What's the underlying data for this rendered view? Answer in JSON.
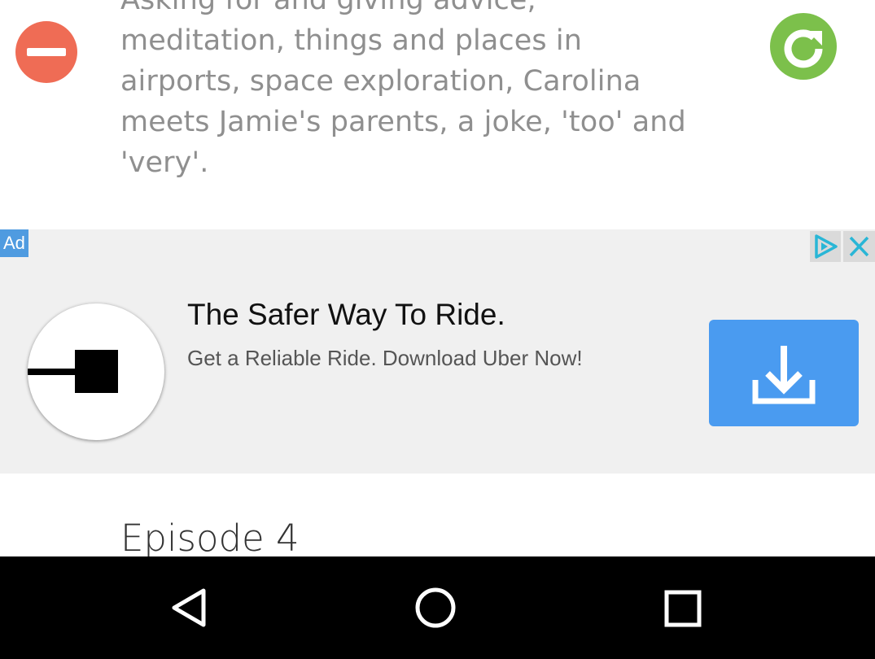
{
  "episode": {
    "description": "Asking for and giving advice, meditation, things and places in airports, space exploration, Carolina meets Jamie's parents, a joke, 'too' and 'very'."
  },
  "ad": {
    "badge": "Ad",
    "headline": "The Safer Way To Ride.",
    "subline": "Get a Reliable Ride. Download Uber Now!",
    "icons": {
      "choices": "ad-choices-icon",
      "close": "close-icon",
      "download": "download-icon",
      "logo": "uber-logo"
    }
  },
  "next_episode": {
    "title": "Episode 4"
  },
  "navbar": {
    "icons": [
      "back-icon",
      "home-icon",
      "recents-icon"
    ]
  },
  "colors": {
    "remove": "#ef6c55",
    "refresh": "#7cc04b",
    "ad_badge": "#4f9be0",
    "ad_button": "#4a9bf0",
    "ad_choices": "#29b6d6"
  }
}
